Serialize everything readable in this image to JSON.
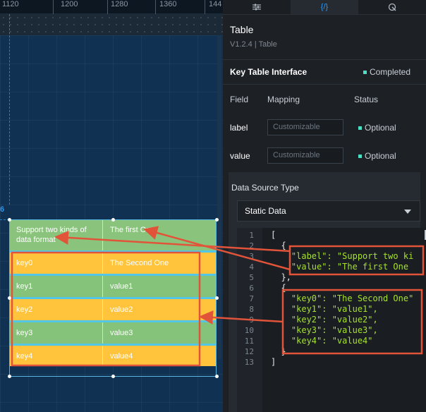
{
  "ruler": {
    "labels": [
      "1120",
      "1200",
      "1280",
      "1360",
      "144"
    ]
  },
  "canvas": {
    "coord_label": "6"
  },
  "table": {
    "header": {
      "col1": "Support two kinds of data format",
      "col2": "The first One"
    },
    "rows": [
      {
        "key": "key0",
        "value": "The Second One",
        "color": "#ffc33c"
      },
      {
        "key": "key1",
        "value": "value1",
        "color": "#85c27a"
      },
      {
        "key": "key2",
        "value": "value2",
        "color": "#ffc33c"
      },
      {
        "key": "key3",
        "value": "value3",
        "color": "#85c27a"
      },
      {
        "key": "key4",
        "value": "value4",
        "color": "#ffc33c"
      }
    ]
  },
  "panel": {
    "tabs": [
      "settings-icon",
      "{/}",
      "data-icon"
    ],
    "active_tab": 1,
    "title": "Table",
    "subtitle": "V1.2.4 | Table",
    "interface_label": "Key Table Interface",
    "interface_status": "Completed",
    "columns": {
      "field": "Field",
      "mapping": "Mapping",
      "status": "Status"
    },
    "fields": [
      {
        "name": "label",
        "placeholder": "Customizable",
        "status": "Optional"
      },
      {
        "name": "value",
        "placeholder": "Customizable",
        "status": "Optional"
      }
    ],
    "data_source_label": "Data Source Type",
    "data_source_value": "Static Data"
  },
  "code": {
    "line_numbers": [
      "1",
      "2",
      "3",
      "4",
      "5",
      "6",
      "7",
      "8",
      "9",
      "10",
      "11",
      "12",
      "13"
    ],
    "lines": [
      "[",
      "  {",
      "    \"label\": \"Support two ki",
      "    \"value\": \"The first One",
      "  },",
      "  {",
      "    \"key0\": \"The Second One\"",
      "    \"key1\": \"value1\",",
      "    \"key2\": \"value2\",",
      "    \"key3\": \"value3\",",
      "    \"key4\": \"value4\"",
      "  }",
      "]"
    ]
  },
  "colors": {
    "accent": "#2b9af3",
    "annotation": "#e2543a",
    "status_dot": "#4be0c4"
  }
}
